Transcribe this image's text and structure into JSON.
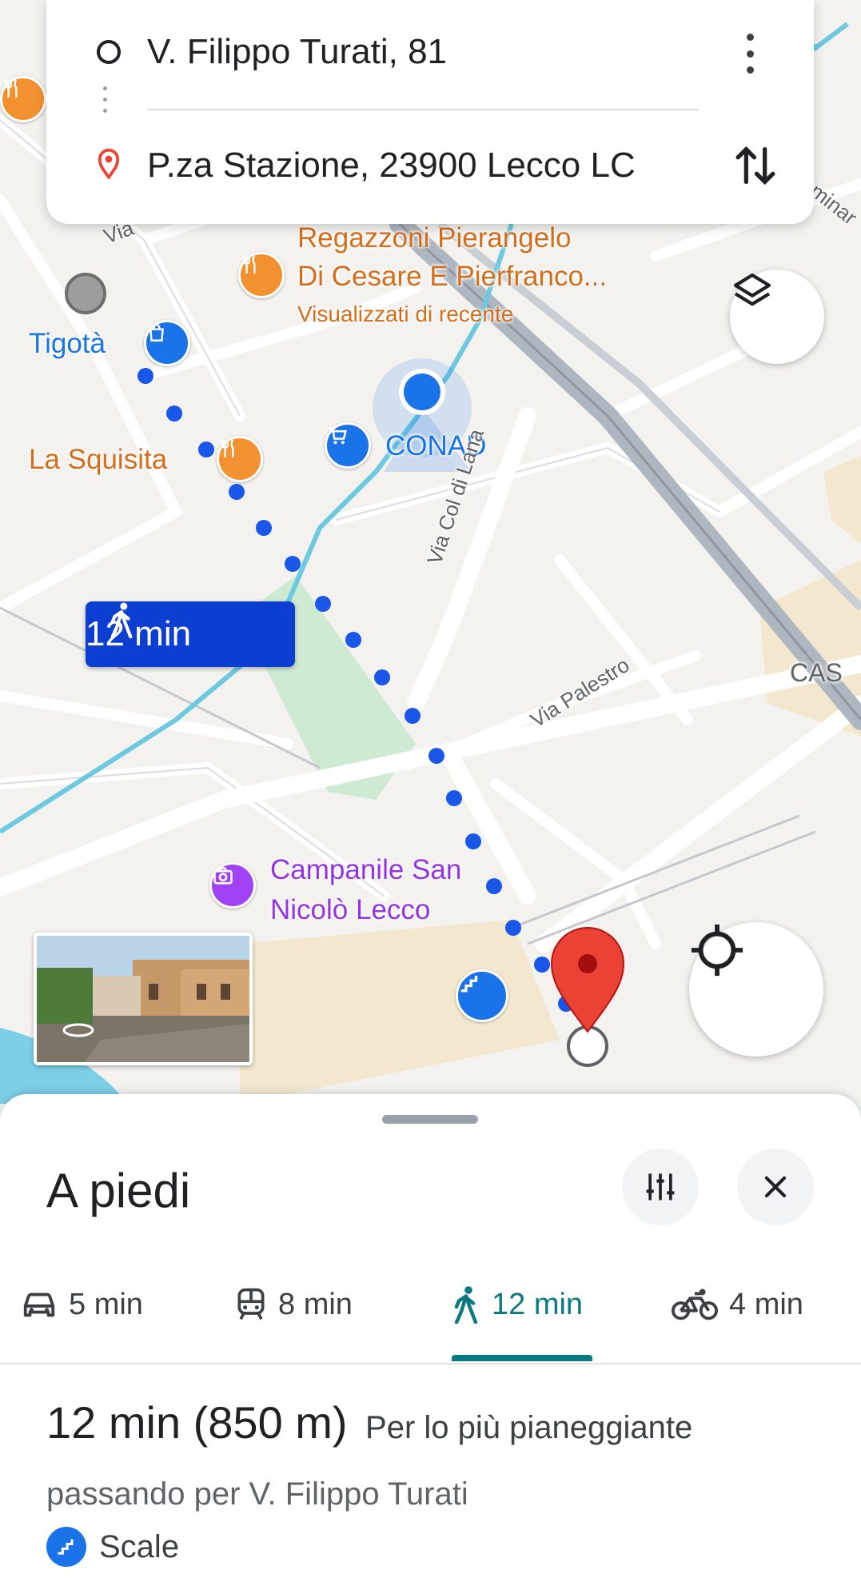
{
  "route": {
    "origin": "V. Filippo Turati, 81",
    "destination": "P.za Stazione, 23900 Lecco LC",
    "menu_icon": "more-vert-icon",
    "swap_icon": "swap-vert-icon"
  },
  "map": {
    "labels": {
      "restaurant_line1": "Regazzoni Pierangelo",
      "restaurant_line2": "Di Cesare E Pierfranco...",
      "restaurant_sub": "Visualizzati di recente",
      "tigota": "Tigotà",
      "la_squisita": "La Squisita",
      "conad": "CONAD",
      "via_col_di_lana": "Via Col di Lana",
      "via_palestro": "Via Palestro",
      "cas": "CAS",
      "campanile_line1": "Campanile San",
      "campanile_line2": "Nicolò Lecco",
      "via_top": "Via",
      "minar": "minar"
    },
    "walk_badge": "12 min",
    "colors": {
      "route": "#1a56e8",
      "badge": "#0b3ed1",
      "pin": "#ea4335",
      "park": "#c8e6c9",
      "water": "#5ec3d9"
    }
  },
  "sheet": {
    "title": "A piedi",
    "options_icon": "tune-icon",
    "close_icon": "close-icon",
    "modes": [
      {
        "icon": "car-icon",
        "label": "5 min"
      },
      {
        "icon": "transit-icon",
        "label": "8 min"
      },
      {
        "icon": "walk-icon",
        "label": "12 min",
        "active": true
      },
      {
        "icon": "bike-icon",
        "label": "4 min"
      }
    ],
    "summary_main": "12 min (850 m)",
    "summary_sub": "Per lo più pianeggiante",
    "via": "passando per V. Filippo Turati",
    "note": "Scale"
  }
}
